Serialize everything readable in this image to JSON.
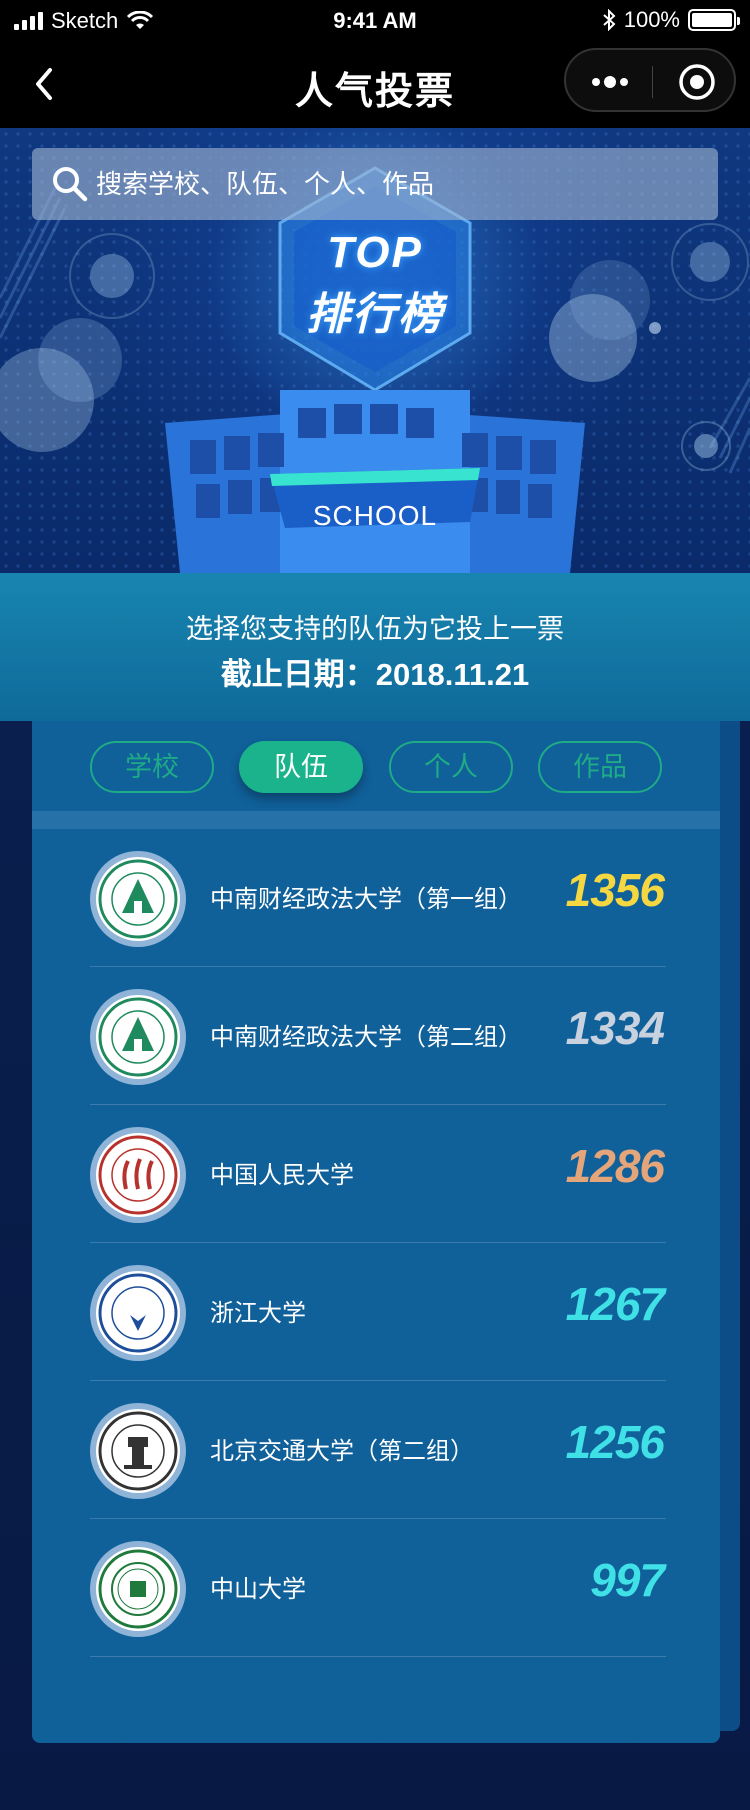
{
  "status_bar": {
    "carrier": "Sketch",
    "time": "9:41 AM",
    "battery_text": "100%"
  },
  "nav": {
    "title": "人气投票"
  },
  "search": {
    "placeholder": "搜索学校、队伍、个人、作品"
  },
  "hero": {
    "top_title": "TOP",
    "top_subtitle": "排行榜",
    "school_label": "SCHOOL"
  },
  "banner": {
    "prompt": "选择您支持的队伍为它投上一票",
    "deadline": "截止日期：2018.11.21"
  },
  "tabs": [
    {
      "label": "学校",
      "active": false
    },
    {
      "label": "队伍",
      "active": true
    },
    {
      "label": "个人",
      "active": false
    },
    {
      "label": "作品",
      "active": false
    }
  ],
  "rankings": [
    {
      "name": "中南财经政法大学（第一组）",
      "votes": "1356",
      "color": "#f5d742",
      "logo": "zuel-logo-icon"
    },
    {
      "name": "中南财经政法大学（第二组）",
      "votes": "1334",
      "color": "#c7d2de",
      "logo": "zuel-logo-icon"
    },
    {
      "name": "中国人民大学",
      "votes": "1286",
      "color": "#e5a57a",
      "logo": "ruc-logo-icon"
    },
    {
      "name": "浙江大学",
      "votes": "1267",
      "color": "#3fe0e6",
      "logo": "zju-logo-icon"
    },
    {
      "name": "北京交通大学（第二组）",
      "votes": "1256",
      "color": "#3fe0e6",
      "logo": "bjtu-logo-icon"
    },
    {
      "name": "中山大学",
      "votes": "997",
      "color": "#3fe0e6",
      "logo": "sysu-logo-icon"
    }
  ],
  "colors": {
    "accent_green": "#1bb38c",
    "banner": "#1885b0",
    "card": "#10609a"
  }
}
